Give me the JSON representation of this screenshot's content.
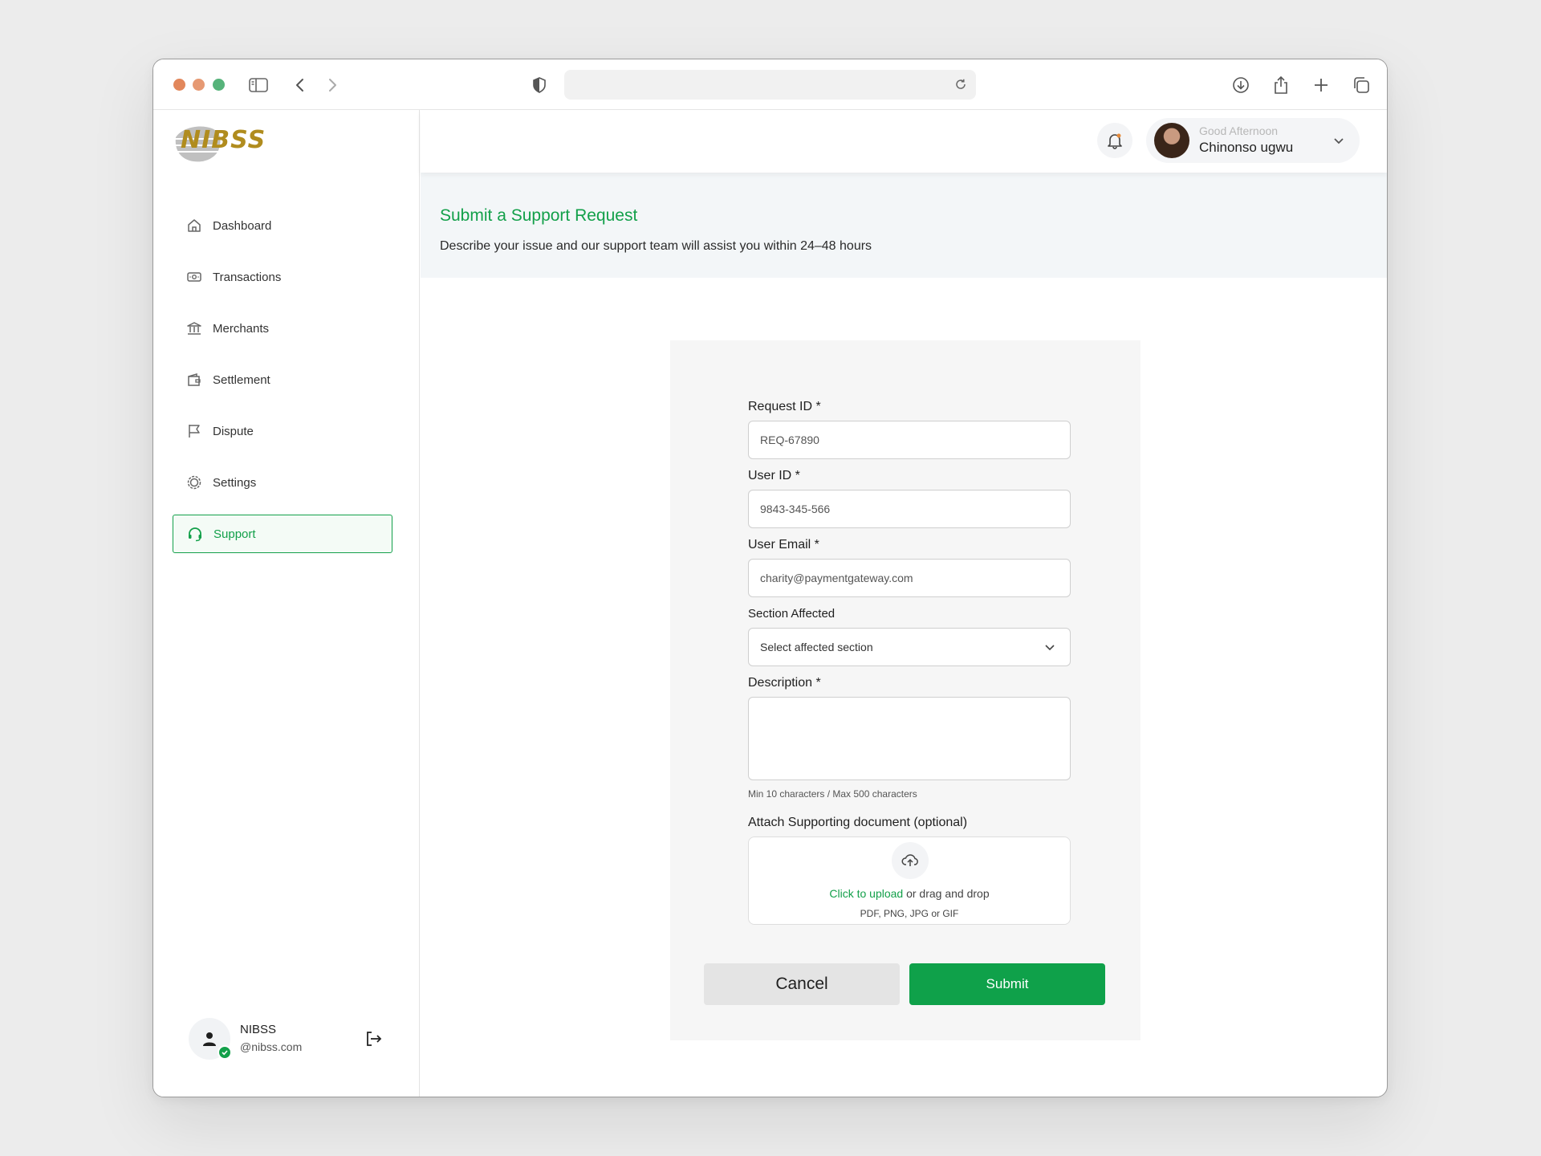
{
  "header": {
    "greeting": "Good Afternoon",
    "user_name": "Chinonso ugwu"
  },
  "sidebar": {
    "logo_text": "NIBSS",
    "items": [
      {
        "label": "Dashboard",
        "icon": "home-icon"
      },
      {
        "label": "Transactions",
        "icon": "money-icon"
      },
      {
        "label": "Merchants",
        "icon": "bank-icon"
      },
      {
        "label": "Settlement",
        "icon": "wallet-icon"
      },
      {
        "label": "Dispute",
        "icon": "flag-icon"
      },
      {
        "label": "Settings",
        "icon": "gear-icon"
      },
      {
        "label": "Support",
        "icon": "headset-icon",
        "active": true
      }
    ],
    "profile": {
      "name": "NIBSS",
      "email": "@nibss.com"
    }
  },
  "banner": {
    "title": "Submit a Support Request",
    "subtitle": "Describe your issue and our support team will assist you within 24–48 hours"
  },
  "form": {
    "request_id": {
      "label": "Request ID *",
      "value": "REQ-67890"
    },
    "user_id": {
      "label": "User ID *",
      "value": "9843-345-566"
    },
    "user_email": {
      "label": "User Email *",
      "value": "charity@paymentgateway.com"
    },
    "section": {
      "label": "Section Affected",
      "placeholder": "Select affected section"
    },
    "description": {
      "label": "Description *",
      "value": "",
      "hint": "Min 10 characters / Max 500 characters"
    },
    "attachment": {
      "label": "Attach Supporting document (optional)",
      "link_text": "Click to upload",
      "rest_text": "or drag and drop",
      "types": "PDF, PNG, JPG or GIF"
    },
    "cancel_label": "Cancel",
    "submit_label": "Submit"
  },
  "colors": {
    "brand_green": "#13a04a",
    "submit_green": "#0fa14a",
    "logo_gold": "#b08c1e"
  }
}
